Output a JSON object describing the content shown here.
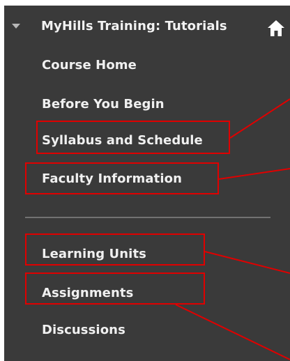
{
  "course_menu": {
    "title": "MyHills Training: Tutorials",
    "items": [
      {
        "label": "Course Home"
      },
      {
        "label": "Before You Begin"
      },
      {
        "label": "Syllabus and Schedule"
      },
      {
        "label": "Faculty Information"
      },
      {
        "label": "Learning Units"
      },
      {
        "label": "Assignments"
      },
      {
        "label": "Discussions"
      }
    ]
  },
  "colors": {
    "panel_background": "#3a3a3a",
    "menu_text": "#f0f0f0",
    "annotation_red": "#e00000",
    "divider": "#727272"
  },
  "icons": {
    "collapse": "caret-down-icon",
    "home": "home-icon"
  }
}
